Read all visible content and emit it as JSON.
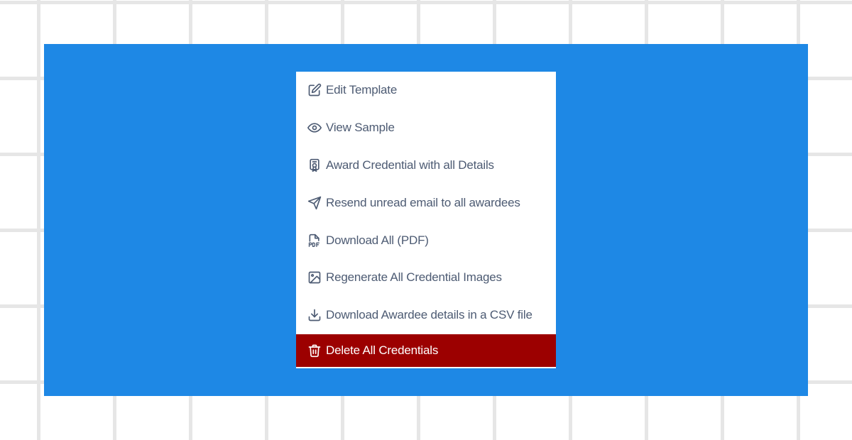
{
  "menu": {
    "items": [
      {
        "label": "Edit Template",
        "icon": "edit-icon"
      },
      {
        "label": "View Sample",
        "icon": "eye-icon"
      },
      {
        "label": "Award Credential with all Details",
        "icon": "badge-icon"
      },
      {
        "label": "Resend unread email to all awardees",
        "icon": "send-icon"
      },
      {
        "label": "Download All (PDF)",
        "icon": "pdf-file-icon"
      },
      {
        "label": "Regenerate All Credential Images",
        "icon": "image-icon"
      },
      {
        "label": "Download Awardee details in a CSV file",
        "icon": "download-icon"
      },
      {
        "label": "Delete All Credentials",
        "icon": "trash-icon"
      }
    ]
  },
  "colors": {
    "panel_background": "#1e88e5",
    "menu_text": "#4d5b73",
    "danger_background": "#9c0000",
    "danger_text": "#ffffff"
  }
}
